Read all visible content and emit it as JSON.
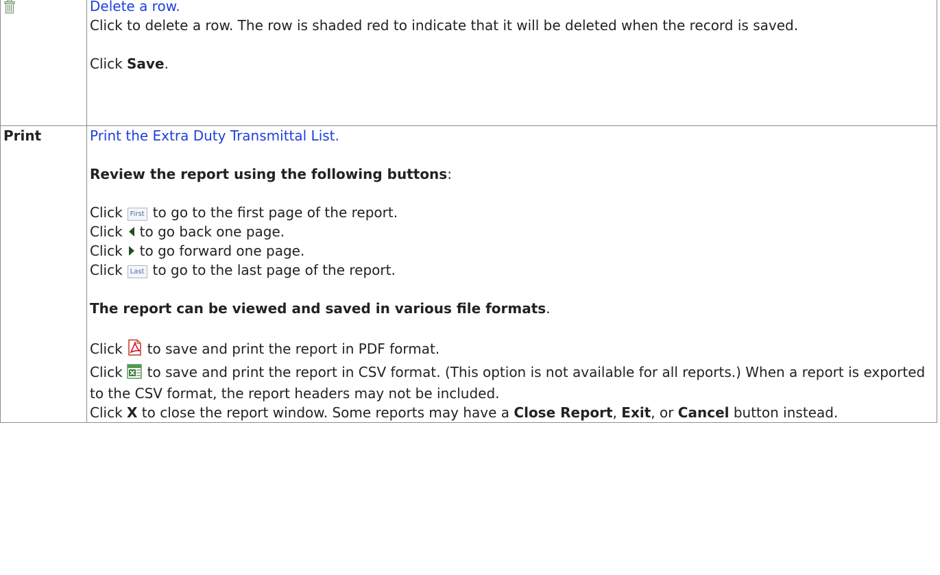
{
  "rows": [
    {
      "icon": "trash-icon",
      "link": "Delete a row.",
      "desc": "Click to delete a row. The row is shaded red to indicate that it will be deleted when the record is saved.",
      "save_pre": "Click ",
      "save_label": "Save",
      "save_post": "."
    },
    {
      "label": "Print",
      "link": "Print the Extra Duty Transmittal List.",
      "review_header": "Review the report using the following buttons",
      "review_colon": ":",
      "click": "Click",
      "first_btn": "First",
      "first_text": "to go to the first page of the report.",
      "prev_text": "to go back one page.",
      "next_text": "to go forward one page.",
      "last_btn": "Last",
      "last_text": "to go to the last page of the report.",
      "formats_header": "The report can be viewed and saved in various file formats",
      "formats_period": ".",
      "pdf_text": "to save and print the report in PDF format.",
      "csv_text": "to save and print the report in CSV format. (This option is not available for all reports.) When a report is exported to the CSV format, the report headers may not be included.",
      "close_pre": "Click ",
      "close_x": "X",
      "close_mid": " to close the report window. Some reports may have a ",
      "close_report": "Close Report",
      "comma1": ", ",
      "exit": "Exit",
      "close_or": ", or ",
      "cancel": "Cancel",
      "close_end": " button instead."
    }
  ],
  "colors": {
    "link": "#1f3fdc",
    "border": "#8c8c8c",
    "nav_arrow": "#1f4f22"
  }
}
